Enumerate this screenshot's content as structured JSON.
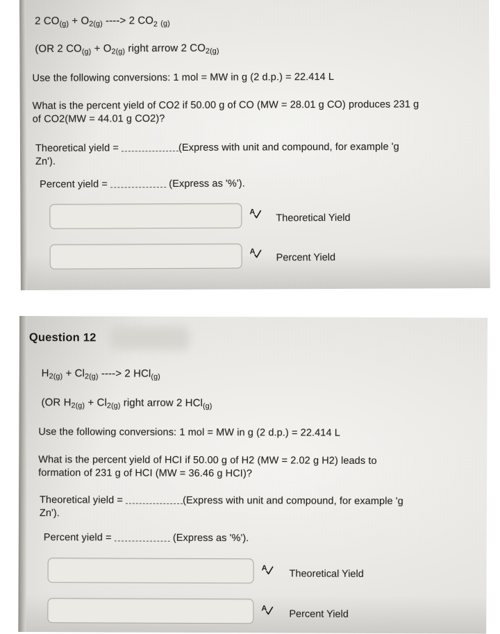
{
  "document": {
    "type": "photographed-screen-homework",
    "panel_count": 2
  },
  "question_11": {
    "equation_main": {
      "prefix_a": "2 CO",
      "sub_a": "(g)",
      "plus": " + O",
      "sub_b": "2(g)",
      "arrow": " ----> 2 CO",
      "sub_c": "2 (g)",
      "plain": "2 CO(g) + O2(g) ----> 2 CO2 (g)"
    },
    "equation_alt": {
      "plain": "(OR 2 CO(g) + O2(g) right arrow 2 CO2(g)"
    },
    "conversions": "Use the following conversions: 1 mol = MW in g (2 d.p.) = 22.414 L",
    "prompt_line1": "What is the percent yield of CO2 if 50.00 g of CO (MW = 28.01 g CO) produces 231 g",
    "prompt_line2": "of CO2(MW = 44.01 g CO2)?",
    "theoretical_label": "Theoretical yield = ",
    "theoretical_hint": "(Express with unit and compound, for example 'g",
    "theoretical_hint2": "Zn').",
    "percent_label": "Percent yield = ",
    "percent_hint": "(Express as '%').",
    "answers": [
      {
        "value": "",
        "placeholder": "",
        "label": "Theoretical Yield",
        "icon": "spellcheck-icon"
      },
      {
        "value": "",
        "placeholder": "",
        "label": "Percent Yield",
        "icon": "spellcheck-icon"
      }
    ]
  },
  "question_12": {
    "title": "Question 12",
    "title_redacted": true,
    "equation_main": {
      "plain": "H2(g) + Cl2(g) ----> 2 HCl(g)"
    },
    "equation_alt": {
      "plain": "(OR H2(g) + Cl2(g) right arrow 2 HCl(g)"
    },
    "conversions": "Use the following conversions: 1 mol = MW in g (2 d.p.) = 22.414 L",
    "prompt_line1": "What is the percent yield of HCI if 50.00 g of H2 (MW = 2.02 g H2) leads to",
    "prompt_line2": "formation of 231 g of HCI (MW = 36.46 g HCI)?",
    "theoretical_label": "Theoretical yield = ",
    "theoretical_hint": "(Express with unit and compound, for example 'g",
    "theoretical_hint2": "Zn').",
    "percent_label": "Percent yield = ",
    "percent_hint": "(Express as '%').",
    "answers": [
      {
        "value": "",
        "placeholder": "",
        "label": "Theoretical Yield",
        "icon": "spellcheck-icon"
      },
      {
        "value": "",
        "placeholder": "",
        "label": "Percent Yield",
        "icon": "spellcheck-icon"
      }
    ]
  },
  "colors": {
    "panel_background": "#efeeea",
    "page_background": "#ffffff",
    "text": "#24241f",
    "input_border": "#a9a7a0",
    "input_fill": "#eceae5"
  }
}
